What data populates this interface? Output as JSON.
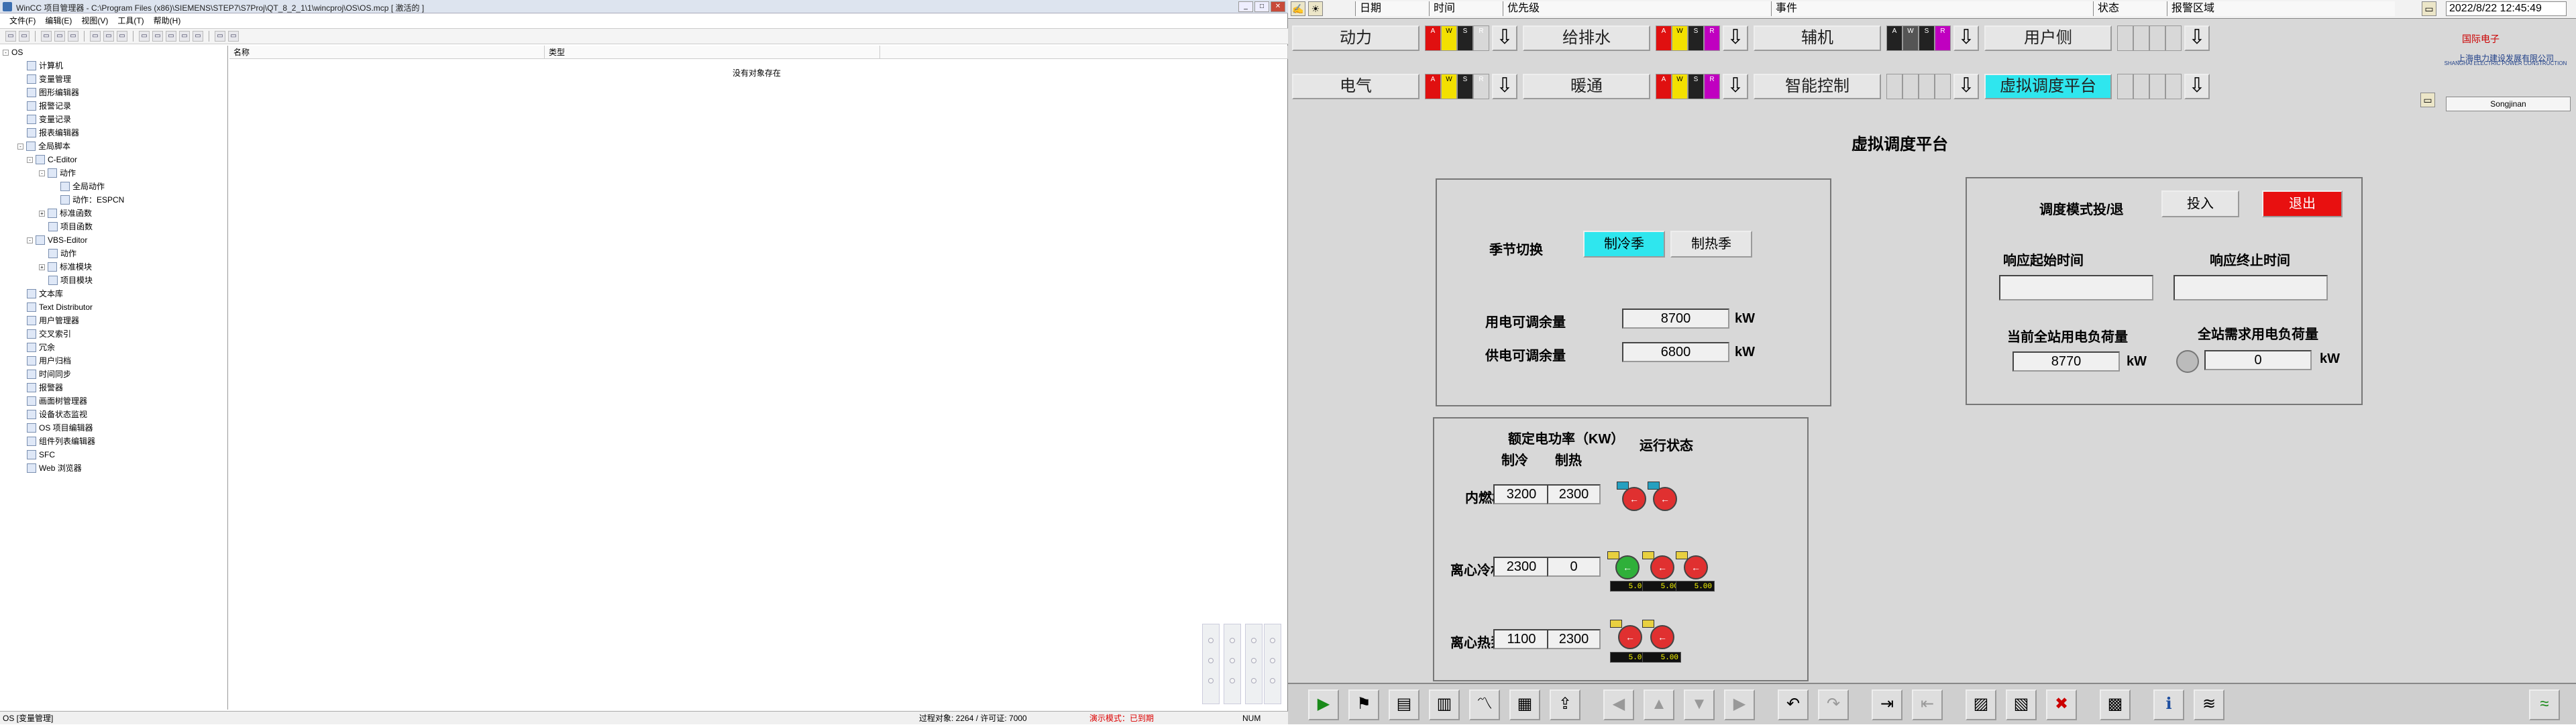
{
  "left": {
    "title": "WinCC 项目管理器 - C:\\Program Files (x86)\\SIEMENS\\STEP7\\S7Proj\\QT_8_2_1\\1\\wincproj\\OS\\OS.mcp [ 激活的 ]",
    "window_buttons": [
      "_",
      "□",
      "✕"
    ],
    "menu": [
      "文件(F)",
      "编辑(E)",
      "视图(V)",
      "工具(T)",
      "帮助(H)"
    ],
    "toolbar": [
      "▭",
      "▭",
      "▭",
      "▭",
      "▭",
      "▭",
      "▭",
      "▭",
      "▭",
      "▭",
      "▭",
      "▭",
      "▭",
      "▭",
      "▭",
      "▭"
    ],
    "tree": [
      "OS",
      "计算机",
      "变量管理",
      "图形编辑器",
      "报警记录",
      "变量记录",
      "报表编辑器",
      "全局脚本",
      "C-Editor",
      "动作",
      "全局动作",
      "动作：ESPCN",
      "标准函数",
      "项目函数",
      "VBS-Editor",
      "动作",
      "标准模块",
      "项目模块",
      "文本库",
      "Text Distributor",
      "用户管理器",
      "交叉索引",
      "冗余",
      "用户归档",
      "时间同步",
      "报警器",
      "画面树管理器",
      "设备状态监视",
      "OS 项目编辑器",
      "组件列表编辑器",
      "SFC",
      "Web 浏览器"
    ],
    "columns": [
      "名称",
      "类型"
    ],
    "empty_text": "没有对象存在",
    "status": {
      "left": "OS [变量管理]",
      "objects": "过程对象: 2264 / 许可证: 7000",
      "mode": "演示模式：已到期",
      "num": "NUM"
    }
  },
  "right": {
    "alarm_headers": [
      "日期",
      "时间",
      "优先级",
      "事件",
      "状态",
      "报警区域"
    ],
    "clock": "2022/8/22 12:45:49",
    "logo": {
      "mark": "国际电子",
      "name": "上海电力建设发展有限公司",
      "sub": "SHANGHAI ELECTRIC POWER CONSTRUCTION"
    },
    "user": "Songjinan",
    "nav_row1": [
      "动力",
      "给排水",
      "辅机",
      "用户侧"
    ],
    "nav_row2": [
      "电气",
      "暖通",
      "智能控制",
      "虚拟调度平台"
    ],
    "ind_letters": [
      "A",
      "W",
      "S",
      "R"
    ],
    "page_title": "虚拟调度平台",
    "season": {
      "label": "季节切换",
      "cool": "制冷季",
      "heat": "制热季",
      "use_label": "用电可调余量",
      "use_val": "8700",
      "supply_label": "供电可调余量",
      "supply_val": "6800",
      "unit": "kW"
    },
    "dispatch": {
      "label": "调度模式投/退",
      "on": "投入",
      "off": "退出",
      "start": "响应起始时间",
      "end": "响应终止时间",
      "cur_label": "当前全站用电负荷量",
      "cur_val": "8770",
      "need_label": "全站需求用电负荷量",
      "need_val": "0",
      "unit": "kW"
    },
    "equip": {
      "rated": "额定电功率（KW）",
      "cool": "制冷",
      "heat": "制热",
      "status": "运行状态",
      "rows": [
        {
          "name": "内燃机",
          "cool": "3200",
          "heat": "2300"
        },
        {
          "name": "离心冷机",
          "cool": "2300",
          "heat": "0"
        },
        {
          "name": "离心热泵",
          "cool": "1100",
          "heat": "2300"
        }
      ],
      "lcd": "5.00",
      "lamp_glyph": "←"
    },
    "toolbar": [
      "▶",
      "⚑",
      "▤",
      "▥",
      "〽",
      "▦",
      "⇪",
      "◀",
      "▲",
      "▼",
      "▶",
      "↶",
      "↷",
      "⇥",
      "⇤",
      "▨",
      "▧",
      "✖",
      "▩",
      "ℹ",
      "≋",
      "≈"
    ]
  }
}
